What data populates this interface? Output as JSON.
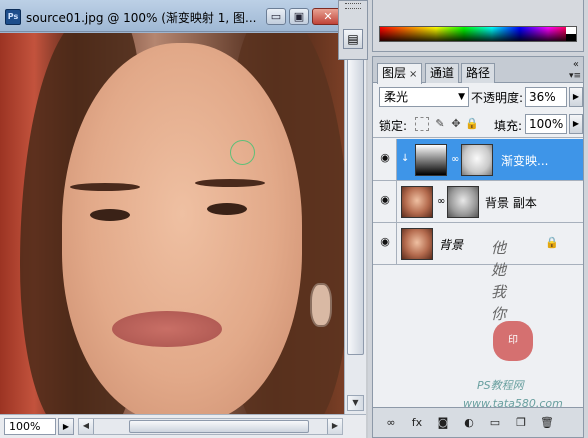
{
  "document": {
    "title": "source01.jpg @ 100% (渐变映射 1, 图...",
    "app_icon": "Ps",
    "zoom": "100%",
    "window_buttons": {
      "minimize": "▭",
      "maximize": "▣",
      "close": "✕"
    }
  },
  "dock": {
    "button_glyph": "▤"
  },
  "layers_panel": {
    "tabs": [
      {
        "label": "图层",
        "active": true,
        "close": "×"
      },
      {
        "label": "通道",
        "active": false
      },
      {
        "label": "路径",
        "active": false
      }
    ],
    "blend_mode": "柔光",
    "opacity_label": "不透明度:",
    "opacity_value": "36%",
    "lock_label": "锁定:",
    "fill_label": "填充:",
    "fill_value": "100%",
    "layers": [
      {
        "name": "渐变映...",
        "selected": true,
        "visible": true,
        "type": "adjustment"
      },
      {
        "name": "背景 副本",
        "selected": false,
        "visible": true,
        "type": "image"
      },
      {
        "name": "背景",
        "selected": false,
        "visible": true,
        "type": "background",
        "locked": true
      }
    ],
    "bottom_icons": [
      "link-icon",
      "fx-icon",
      "mask-icon",
      "adjustment-icon",
      "group-icon",
      "new-layer-icon",
      "trash-icon"
    ]
  },
  "colors": {
    "selected_layer": "#3e95e8",
    "panel_bg": "#eef0f3"
  }
}
